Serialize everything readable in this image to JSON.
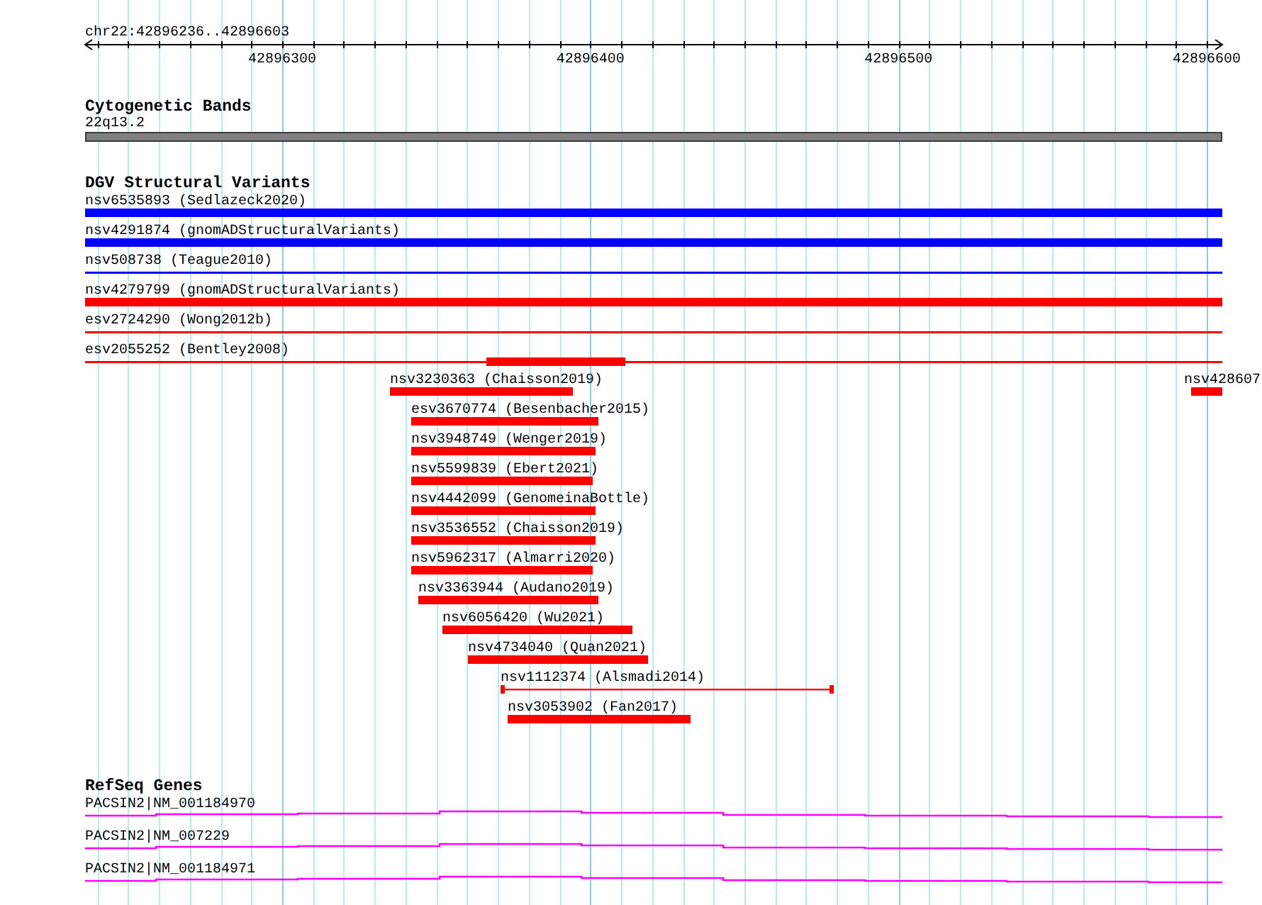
{
  "ruler": {
    "location": "chr22:42896236..42896603",
    "ticks": [
      "42896300",
      "42896400",
      "42896500",
      "42896600"
    ]
  },
  "tracks": [
    {
      "kind": "bands",
      "title": "Cytogenetic Bands",
      "features": [
        {
          "label": "22q13.2"
        }
      ]
    },
    {
      "kind": "variants",
      "title": "DGV Structural Variants",
      "rows": [
        {
          "features": [
            {
              "label": "nsv6535893 (Sedlazeck2020)",
              "color": "#0000ff",
              "kind": "thick"
            }
          ]
        },
        {
          "features": [
            {
              "label": "nsv4291874 (gnomADStructuralVariants)",
              "color": "#0000ff",
              "kind": "thick"
            }
          ]
        },
        {
          "features": [
            {
              "label": "nsv508738 (Teague2010)",
              "color": "#0000ff",
              "kind": "thin"
            }
          ]
        },
        {
          "features": [
            {
              "label": "nsv4279799 (gnomADStructuralVariants)",
              "color": "#ff0000",
              "kind": "thick"
            }
          ]
        },
        {
          "features": [
            {
              "label": "esv2724290 (Wong2012b)",
              "color": "#ff0000",
              "kind": "thin"
            }
          ]
        },
        {
          "features": [
            {
              "label": "esv2055252 (Bentley2008)",
              "color": "#ff0000",
              "kind": "thin"
            },
            {
              "color": "#ff0000",
              "kind": "thick"
            }
          ]
        },
        {
          "features": [
            {
              "label": "nsv3230363 (Chaisson2019)",
              "color": "#ff0000",
              "kind": "thick"
            },
            {
              "label": "nsv428607",
              "color": "#ff0000",
              "kind": "thick"
            }
          ]
        },
        {
          "features": [
            {
              "label": "esv3670774 (Besenbacher2015)",
              "color": "#ff0000",
              "kind": "thick"
            }
          ]
        },
        {
          "features": [
            {
              "label": "nsv3948749 (Wenger2019)",
              "color": "#ff0000",
              "kind": "thick"
            }
          ]
        },
        {
          "features": [
            {
              "label": "nsv5599839 (Ebert2021)",
              "color": "#ff0000",
              "kind": "thick"
            }
          ]
        },
        {
          "features": [
            {
              "label": "nsv4442099 (GenomeinaBottle)",
              "color": "#ff0000",
              "kind": "thick"
            }
          ]
        },
        {
          "features": [
            {
              "label": "nsv3536552 (Chaisson2019)",
              "color": "#ff0000",
              "kind": "thick"
            }
          ]
        },
        {
          "features": [
            {
              "label": "nsv5962317 (Almarri2020)",
              "color": "#ff0000",
              "kind": "thick"
            }
          ]
        },
        {
          "features": [
            {
              "label": "nsv3363944 (Audano2019)",
              "color": "#ff0000",
              "kind": "thick"
            }
          ]
        },
        {
          "features": [
            {
              "label": "nsv6056420 (Wu2021)",
              "color": "#ff0000",
              "kind": "thick"
            }
          ]
        },
        {
          "features": [
            {
              "label": "nsv4734040 (Quan2021)",
              "color": "#ff0000",
              "kind": "thick"
            }
          ]
        },
        {
          "features": [
            {
              "label": "nsv1112374 (Alsmadi2014)",
              "color": "#ff0000",
              "kind": "split"
            }
          ]
        },
        {
          "features": [
            {
              "label": "nsv3053902 (Fan2017)",
              "color": "#ff0000",
              "kind": "thick"
            }
          ]
        }
      ]
    },
    {
      "kind": "genes",
      "title": "RefSeq Genes",
      "features": [
        {
          "label": "PACSIN2|NM_001184970"
        },
        {
          "label": "PACSIN2|NM_007229"
        },
        {
          "label": "PACSIN2|NM_001184971"
        }
      ]
    }
  ]
}
